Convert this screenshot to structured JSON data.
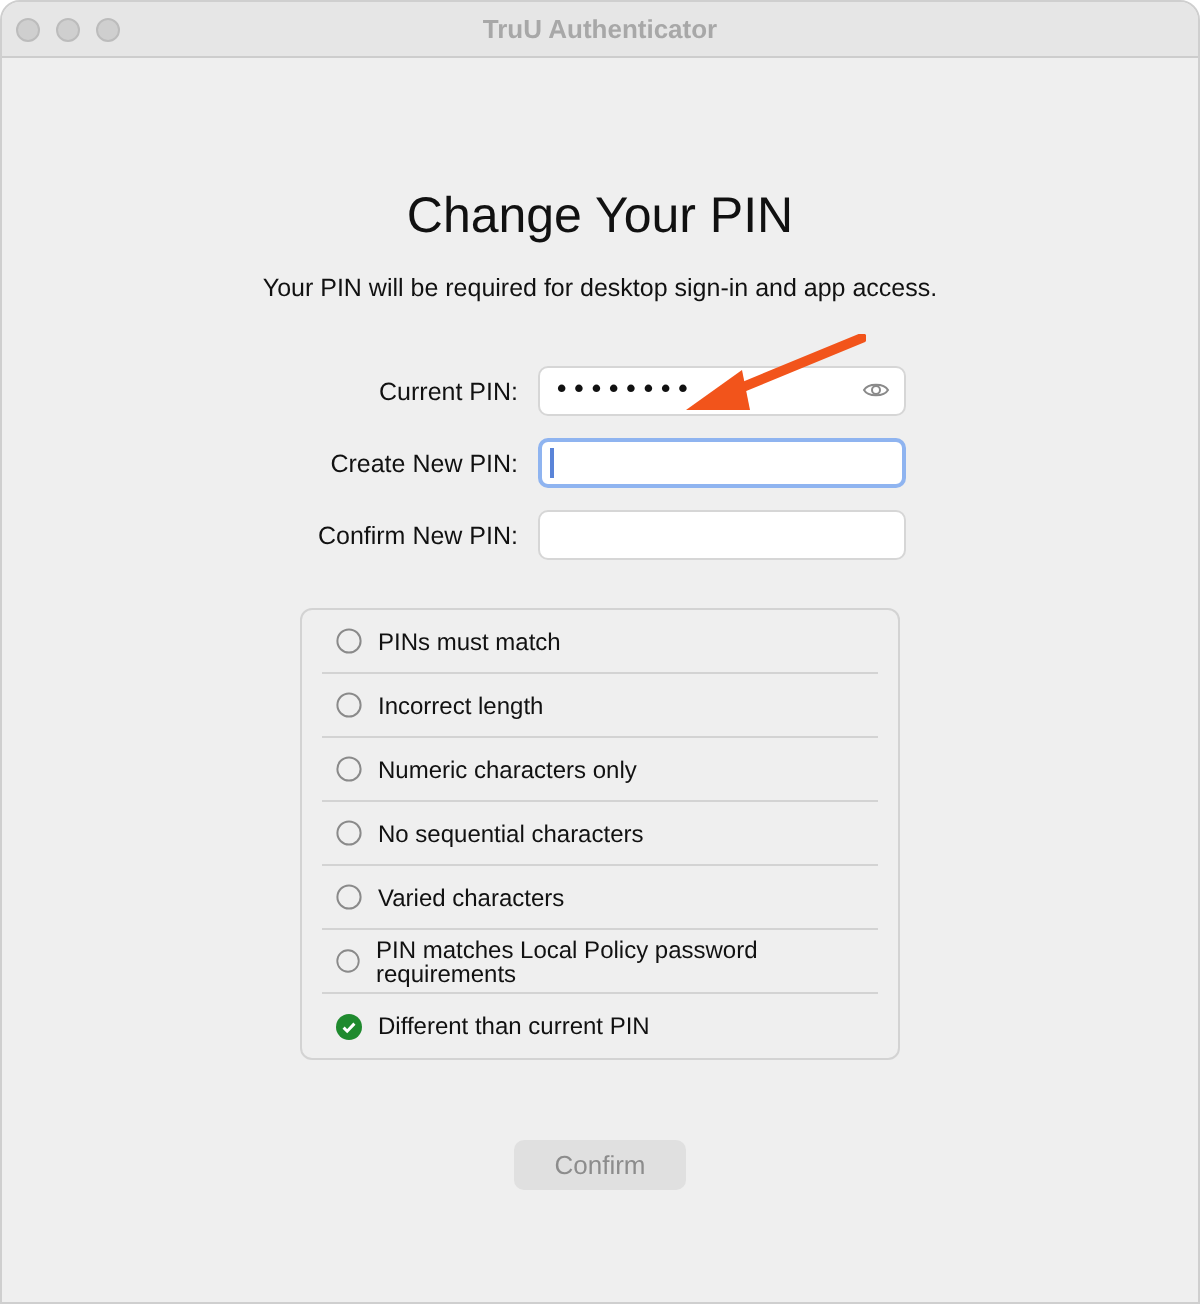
{
  "window": {
    "title": "TruU Authenticator"
  },
  "heading": "Change Your PIN",
  "subtitle": "Your PIN will be required for desktop sign-in and app access.",
  "fields": [
    {
      "label": "Current PIN:",
      "value": "••••••••",
      "kind": "password",
      "focused": false
    },
    {
      "label": "Create New PIN:",
      "kind": "text",
      "focused": true
    },
    {
      "label": "Confirm New PIN:",
      "kind": "text",
      "focused": false
    }
  ],
  "requirements": [
    {
      "label": "PINs must match",
      "met": false
    },
    {
      "label": "Incorrect length",
      "met": false
    },
    {
      "label": "Numeric characters only",
      "met": false
    },
    {
      "label": "No sequential characters",
      "met": false
    },
    {
      "label": "Varied characters",
      "met": false
    },
    {
      "label": "PIN matches Local Policy password requirements",
      "met": false
    },
    {
      "label": "Different than current PIN",
      "met": true
    }
  ],
  "confirm_button": {
    "label": "Confirm",
    "disabled": true
  }
}
